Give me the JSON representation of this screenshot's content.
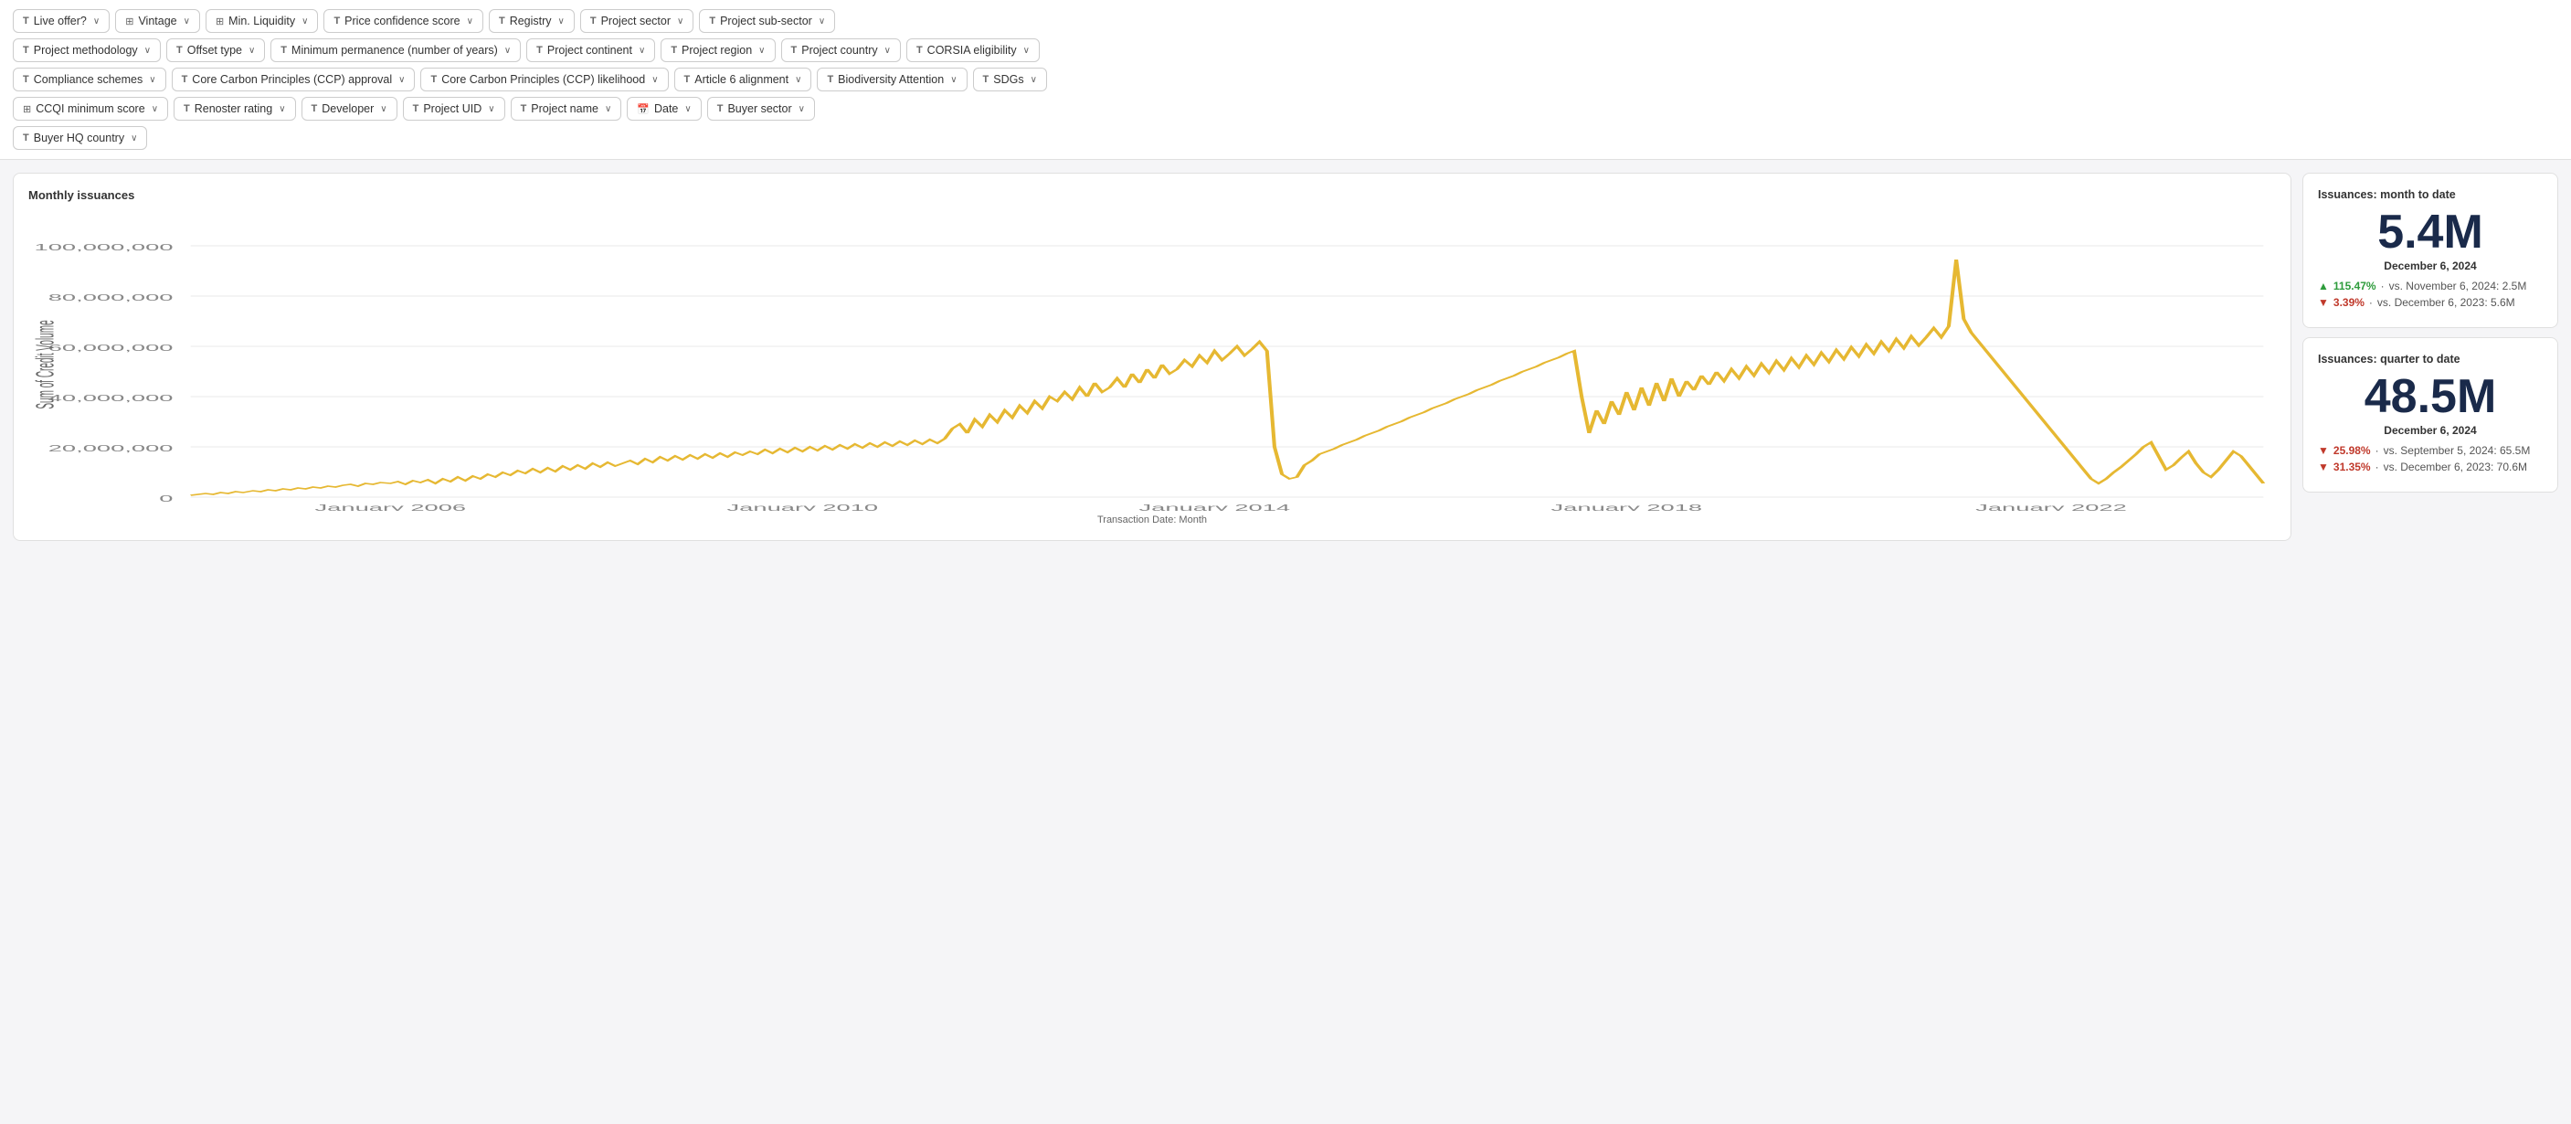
{
  "filters": {
    "rows": [
      [
        {
          "label": "Live offer?",
          "icon": "T",
          "type": "text"
        },
        {
          "label": "Vintage",
          "icon": "☐",
          "type": "calendar"
        },
        {
          "label": "Min. Liquidity",
          "icon": "☐",
          "type": "calendar"
        },
        {
          "label": "Price confidence score",
          "icon": "T",
          "type": "text"
        },
        {
          "label": "Registry",
          "icon": "T",
          "type": "text"
        },
        {
          "label": "Project sector",
          "icon": "T",
          "type": "text"
        },
        {
          "label": "Project sub-sector",
          "icon": "T",
          "type": "text"
        }
      ],
      [
        {
          "label": "Project methodology",
          "icon": "T",
          "type": "text"
        },
        {
          "label": "Offset type",
          "icon": "T",
          "type": "text"
        },
        {
          "label": "Minimum permanence (number of years)",
          "icon": "T",
          "type": "text"
        },
        {
          "label": "Project continent",
          "icon": "T",
          "type": "text"
        },
        {
          "label": "Project region",
          "icon": "T",
          "type": "text"
        },
        {
          "label": "Project country",
          "icon": "T",
          "type": "text"
        },
        {
          "label": "CORSIA eligibility",
          "icon": "T",
          "type": "text"
        }
      ],
      [
        {
          "label": "Compliance schemes",
          "icon": "T",
          "type": "text"
        },
        {
          "label": "Core Carbon Principles (CCP) approval",
          "icon": "T",
          "type": "text"
        },
        {
          "label": "Core Carbon Principles (CCP) likelihood",
          "icon": "T",
          "type": "text"
        },
        {
          "label": "Article 6 alignment",
          "icon": "T",
          "type": "text"
        },
        {
          "label": "Biodiversity Attention",
          "icon": "T",
          "type": "text"
        },
        {
          "label": "SDGs",
          "icon": "T",
          "type": "text"
        }
      ],
      [
        {
          "label": "CCQI minimum score",
          "icon": "☐",
          "type": "calendar"
        },
        {
          "label": "Renoster rating",
          "icon": "T",
          "type": "text"
        },
        {
          "label": "Developer",
          "icon": "T",
          "type": "text"
        },
        {
          "label": "Project UID",
          "icon": "T",
          "type": "text"
        },
        {
          "label": "Project name",
          "icon": "T",
          "type": "text"
        },
        {
          "label": "Date",
          "icon": "📅",
          "type": "date"
        },
        {
          "label": "Buyer sector",
          "icon": "T",
          "type": "text"
        }
      ],
      [
        {
          "label": "Buyer HQ country",
          "icon": "T",
          "type": "text"
        }
      ]
    ]
  },
  "chart": {
    "title": "Monthly issuances",
    "x_axis_label": "Transaction Date: Month",
    "y_axis_label": "Sum of Credit Volume",
    "y_ticks": [
      "0",
      "20,000,000",
      "40,000,000",
      "60,000,000",
      "80,000,000",
      "100,000,000"
    ],
    "x_ticks": [
      "January 2006",
      "January 2010",
      "January 2014",
      "January 2018",
      "January 2022"
    ],
    "more_icon": "⋯"
  },
  "stats": {
    "month_card": {
      "title": "Issuances: month to date",
      "big_number": "5.4M",
      "date": "December 6, 2024",
      "comparisons": [
        {
          "direction": "up",
          "pct": "115.47%",
          "label": "vs. November 6, 2024: 2.5M"
        },
        {
          "direction": "down",
          "pct": "3.39%",
          "label": "vs. December 6, 2023: 5.6M"
        }
      ]
    },
    "quarter_card": {
      "title": "Issuances: quarter to date",
      "big_number": "48.5M",
      "date": "December 6, 2024",
      "comparisons": [
        {
          "direction": "down",
          "pct": "25.98%",
          "label": "vs. September 5, 2024: 65.5M"
        },
        {
          "direction": "down",
          "pct": "31.35%",
          "label": "vs. December 6, 2023: 70.6M"
        }
      ]
    }
  }
}
